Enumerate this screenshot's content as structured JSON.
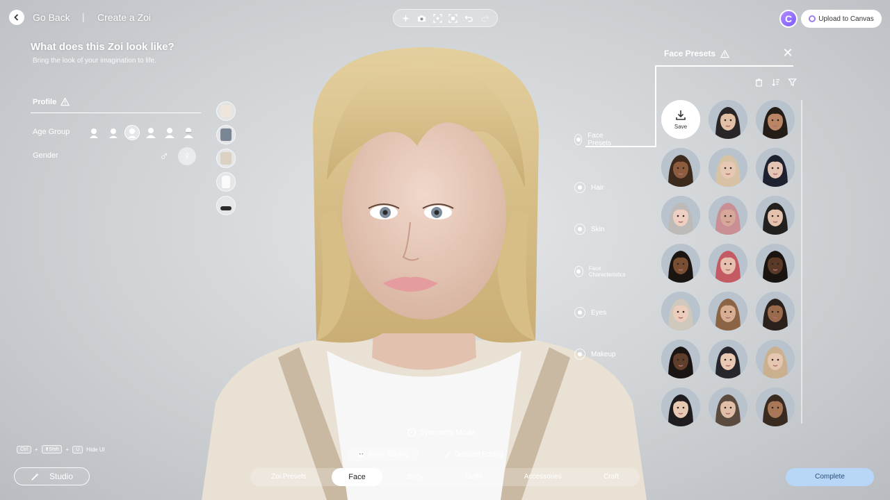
{
  "header": {
    "back_label": "Go Back",
    "separator": "|",
    "crumb": "Create a Zoi",
    "canvas_avatar_letter": "C",
    "upload_label": "Upload to Canvas",
    "tools": [
      "sparkle-icon",
      "camera-icon",
      "frame-icon",
      "focus-icon",
      "undo-icon",
      "redo-icon"
    ]
  },
  "left": {
    "title": "What does this Zoi look like?",
    "subtitle": "Bring the look of your imagination to life.",
    "profile_tab": "Profile",
    "age_label": "Age Group",
    "gender_label": "Gender",
    "gender_male": "♂",
    "gender_female": "♀",
    "age_selected_index": 2
  },
  "right": {
    "header": "Face Presets",
    "close": "✕",
    "save_label": "Save",
    "categories": [
      "Face Presets",
      "Hair",
      "Skin",
      "Face Characteristics",
      "Eyes",
      "Makeup"
    ],
    "presets": [
      {
        "skin": "#e2c0a6",
        "hair": "#2a2526"
      },
      {
        "skin": "#b98565",
        "hair": "#241c17"
      },
      {
        "skin": "#8d5c3e",
        "hair": "#3c2a1c"
      },
      {
        "skin": "#e7c8b4",
        "hair": "#d8c2a6"
      },
      {
        "skin": "#e4c4b2",
        "hair": "#1e2230"
      },
      {
        "skin": "#edd0c2",
        "hair": "#bdbab8"
      },
      {
        "skin": "#d7a89a",
        "hair": "#c98f94"
      },
      {
        "skin": "#e4c2ae",
        "hair": "#22201e"
      },
      {
        "skin": "#7a4e33",
        "hair": "#1b1512"
      },
      {
        "skin": "#e6bfae",
        "hair": "#c45a64"
      },
      {
        "skin": "#5a3a27",
        "hair": "#1a1410"
      },
      {
        "skin": "#ecccbb",
        "hair": "#cfc8bc"
      },
      {
        "skin": "#d8ae92",
        "hair": "#8a6444"
      },
      {
        "skin": "#9a6a4c",
        "hair": "#2b211c"
      },
      {
        "skin": "#5f3e2c",
        "hair": "#1a1512"
      },
      {
        "skin": "#e9c8b4",
        "hair": "#27262c"
      },
      {
        "skin": "#e5c7b1",
        "hair": "#cbb08f"
      },
      {
        "skin": "#e8c9b4",
        "hair": "#1f1d1f"
      },
      {
        "skin": "#e1bfa6",
        "hair": "#5b4a3e"
      },
      {
        "skin": "#a87758",
        "hair": "#3a2b21"
      }
    ]
  },
  "bottom": {
    "hint_keys": [
      "Ctrl",
      "⬆Shift",
      "U"
    ],
    "hint_plus": "+",
    "hint_label": "Hide UI",
    "studio_label": "Studio",
    "symmetry_label": "Symmetry Mode",
    "basic_editing": "Basic Editing",
    "detailed_editing": "Detailed Editing",
    "tabs": [
      "Zoi Presets",
      "Face",
      "Body",
      "Outfit",
      "Accessories",
      "Craft"
    ],
    "selected_tab": "Face",
    "complete_label": "Complete"
  },
  "colors": {
    "accent_complete": "#b8d6f6",
    "brand_purple": "#a07cf0",
    "hair_blonde": "#dcc48e",
    "cardigan": "#e9e1d4"
  }
}
